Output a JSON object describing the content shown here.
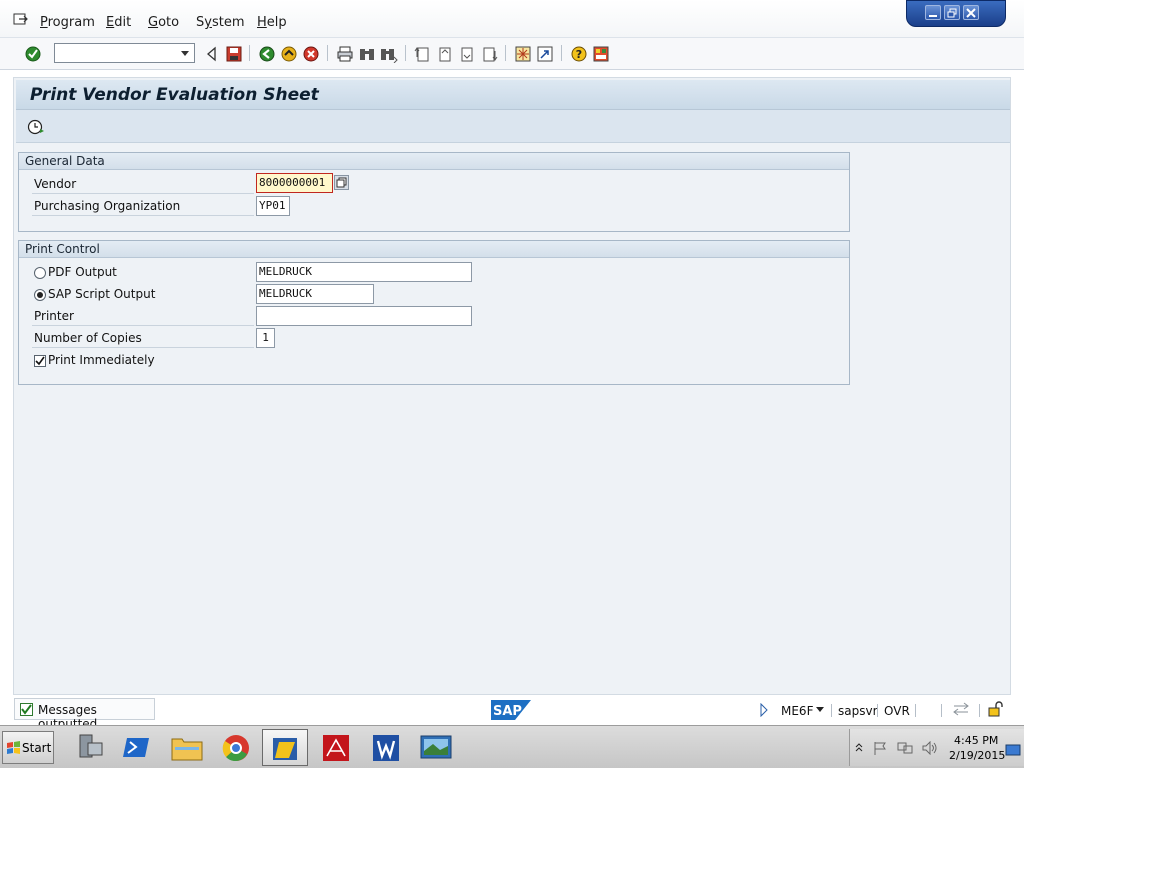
{
  "menu": {
    "items": [
      {
        "label": "Program",
        "key": "P"
      },
      {
        "label": "Edit",
        "key": "E"
      },
      {
        "label": "Goto",
        "key": "G"
      },
      {
        "label": "System",
        "key": "y"
      },
      {
        "label": "Help",
        "key": "H"
      }
    ]
  },
  "toolbar": {
    "command_field_value": "",
    "icons": [
      "enter-icon",
      "back-arrow-icon",
      "save-icon",
      "back-icon",
      "exit-icon",
      "cancel-icon",
      "print-icon",
      "find-icon",
      "find-next-icon",
      "first-page-icon",
      "previous-page-icon",
      "next-page-icon",
      "last-page-icon",
      "create-session-icon",
      "create-shortcut-icon",
      "help-icon",
      "customize-layout-icon"
    ]
  },
  "screen": {
    "title": "Print Vendor Evaluation Sheet",
    "execute_icon": "execute-icon"
  },
  "general_data": {
    "heading": "General Data",
    "vendor_label": "Vendor",
    "vendor_value": "8000000001",
    "purch_org_label": "Purchasing Organization",
    "purch_org_value": "YP01"
  },
  "print_control": {
    "heading": "Print Control",
    "pdf_label": "PDF Output",
    "pdf_value": "MELDRUCK",
    "pdf_selected": false,
    "sapscript_label": "SAP Script Output",
    "sapscript_value": "MELDRUCK",
    "sapscript_selected": true,
    "printer_label": "Printer",
    "printer_value": "",
    "copies_label": "Number of Copies",
    "copies_value": "1",
    "print_immediately_label": "Print Immediately",
    "print_immediately_checked": true
  },
  "status": {
    "message": "Messages outputted",
    "logo": "SAP",
    "transaction": "ME6F",
    "server": "sapsvr",
    "mode": "OVR"
  },
  "taskbar": {
    "start_label": "Start",
    "time": "4:45 PM",
    "date": "2/19/2015"
  },
  "colors": {
    "title_bg": "#d3e1ed",
    "required_field_bg": "#fff8cc",
    "required_field_border": "#c0271f"
  }
}
